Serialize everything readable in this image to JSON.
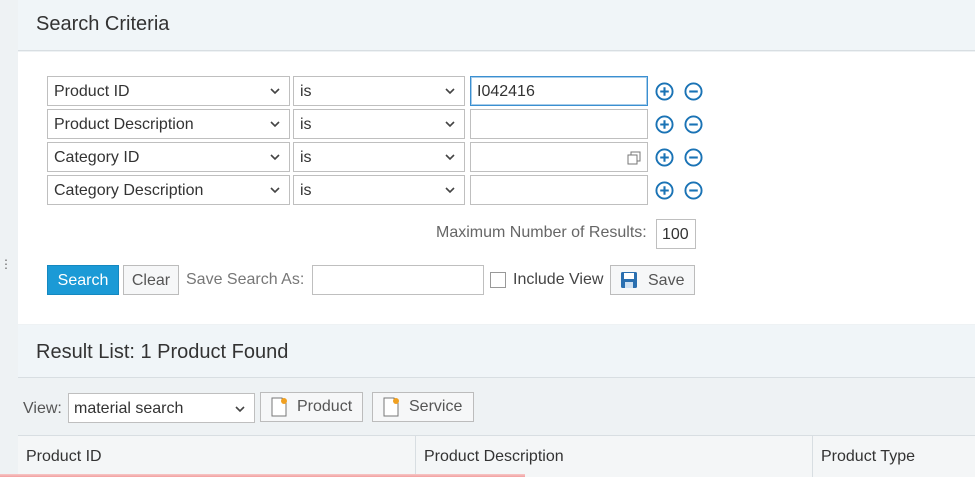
{
  "search_criteria": {
    "title": "Search Criteria",
    "rows": [
      {
        "field": "Product ID",
        "operator": "is",
        "value": "I042416"
      },
      {
        "field": "Product Description",
        "operator": "is",
        "value": ""
      },
      {
        "field": "Category ID",
        "operator": "is",
        "value": ""
      },
      {
        "field": "Category Description",
        "operator": "is",
        "value": ""
      }
    ],
    "max_results_label": "Maximum Number of Results:",
    "max_results_value": "100",
    "search_label": "Search",
    "clear_label": "Clear",
    "save_search_as_label": "Save Search As:",
    "save_search_as_value": "",
    "include_view_label": "Include View",
    "include_view_checked": false,
    "save_label": "Save"
  },
  "result_list": {
    "title": "Result List: 1 Product Found",
    "view_label": "View:",
    "view_value": "material search",
    "product_btn_label": "Product",
    "service_btn_label": "Service",
    "columns": [
      "Product ID",
      "Product Description",
      "Product Type"
    ]
  },
  "colors": {
    "accent": "#1b9ad6",
    "icon_blue": "#1a73b5"
  }
}
